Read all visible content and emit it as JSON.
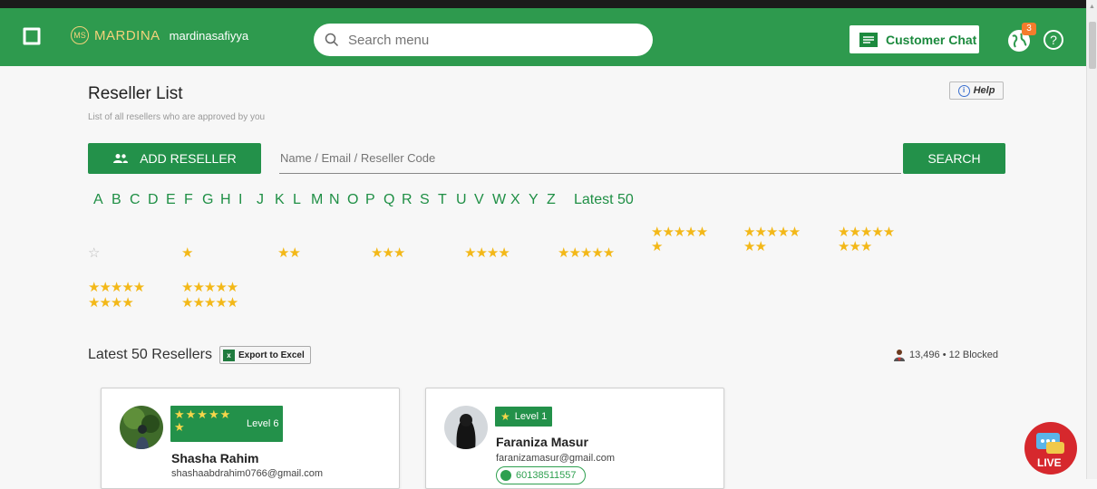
{
  "header": {
    "brand_mark": "MS",
    "brand_name": "MARDINA",
    "username": "mardinasafiyya",
    "search_placeholder": "Search menu",
    "customer_chat_label": "Customer Chat",
    "notification_count": "3",
    "help_glyph": "?"
  },
  "page": {
    "title": "Reseller List",
    "subtitle": "List of all resellers who are approved by you",
    "help_label": "Help"
  },
  "toolbar": {
    "add_label": "ADD RESELLER",
    "search_placeholder": "Name / Email / Reseller Code",
    "search_label": "SEARCH"
  },
  "alphabet": [
    "A",
    "B",
    "C",
    "D",
    "E",
    "F",
    "G",
    "H",
    "I",
    "J",
    "K",
    "L",
    "M",
    "N",
    "O",
    "P",
    "Q",
    "R",
    "S",
    "T",
    "U",
    "V",
    "W",
    "X",
    "Y",
    "Z"
  ],
  "alphabet_latest": "Latest 50",
  "star_filters": {
    "row1": [
      0,
      1,
      2,
      3,
      4,
      5,
      6,
      7,
      8
    ],
    "row2": [
      9,
      10
    ]
  },
  "latest_section": {
    "title": "Latest 50 Resellers",
    "export_label": "Export to Excel",
    "count_text": "13,496 • 12 Blocked"
  },
  "resellers": [
    {
      "name": "Shasha Rahim",
      "email": "shashaabdrahim0766@gmail.com",
      "stars": 6,
      "level": "Level 6",
      "phone": ""
    },
    {
      "name": "Faraniza Masur",
      "email": "faranizamasur@gmail.com",
      "stars": 1,
      "level": "Level 1",
      "phone": "60138511557"
    }
  ],
  "live_chat_label": "LIVE",
  "colors": {
    "header_green": "#2e9a4e",
    "button_green": "#23914a",
    "star_gold": "#f3b818",
    "brand_gold": "#f3d27a"
  }
}
